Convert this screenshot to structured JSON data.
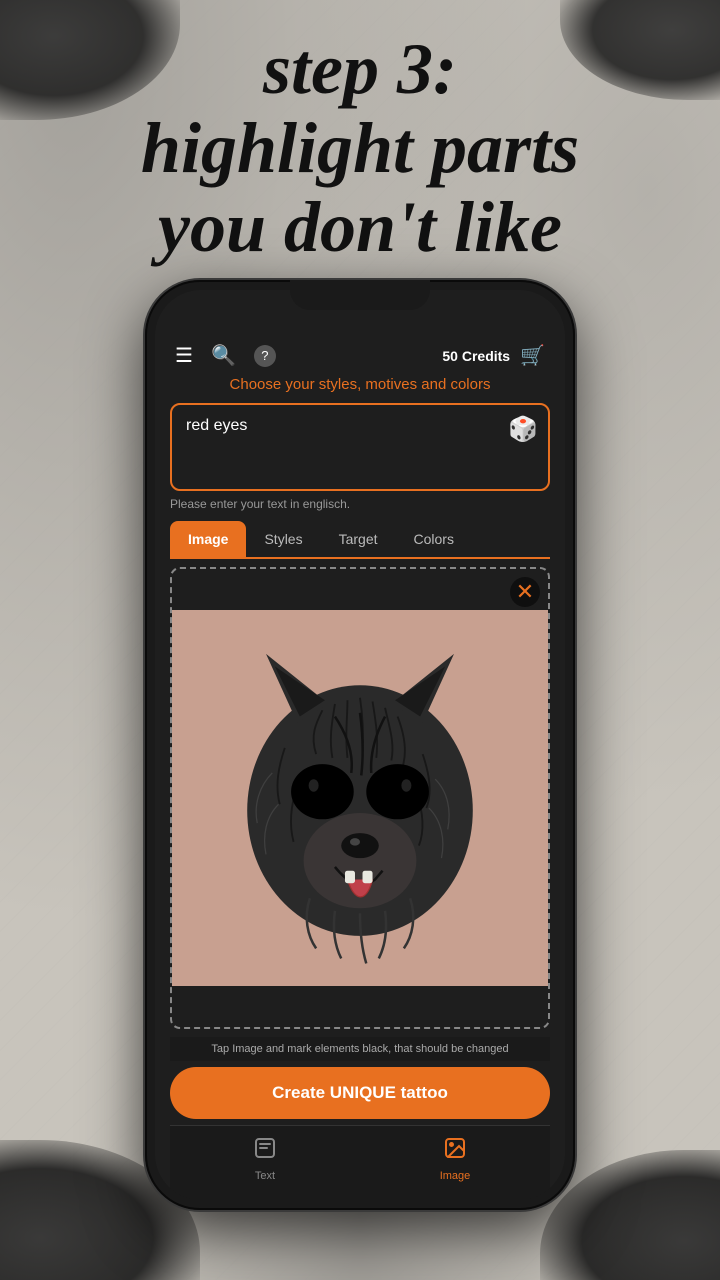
{
  "heading": {
    "line1": "step 3:",
    "line2": "highlight parts",
    "line3": "you don't like"
  },
  "app": {
    "header": {
      "menu_icon": "☰",
      "search_icon": "🔍",
      "help_icon": "?",
      "credits": "50 Credits",
      "cart_icon": "🛒"
    },
    "subtitle": "Choose your styles, motives and colors",
    "input": {
      "value": "red eyes",
      "placeholder": "red eyes",
      "hint": "Please enter your text in englisch.",
      "dice_icon": "🎲"
    },
    "tabs": [
      {
        "id": "image",
        "label": "Image",
        "active": true
      },
      {
        "id": "styles",
        "label": "Styles",
        "active": false
      },
      {
        "id": "target",
        "label": "Target",
        "active": false
      },
      {
        "id": "colors",
        "label": "Colors",
        "active": false
      }
    ],
    "image_area": {
      "caption": "Tap Image and mark elements black, that should be changed",
      "close_icon": "✕"
    },
    "cta_button": "Create UNIQUE tattoo",
    "bottom_nav": [
      {
        "id": "text",
        "label": "Text",
        "icon": "💬",
        "active": false
      },
      {
        "id": "image",
        "label": "Image",
        "icon": "🖼",
        "active": true
      }
    ]
  }
}
